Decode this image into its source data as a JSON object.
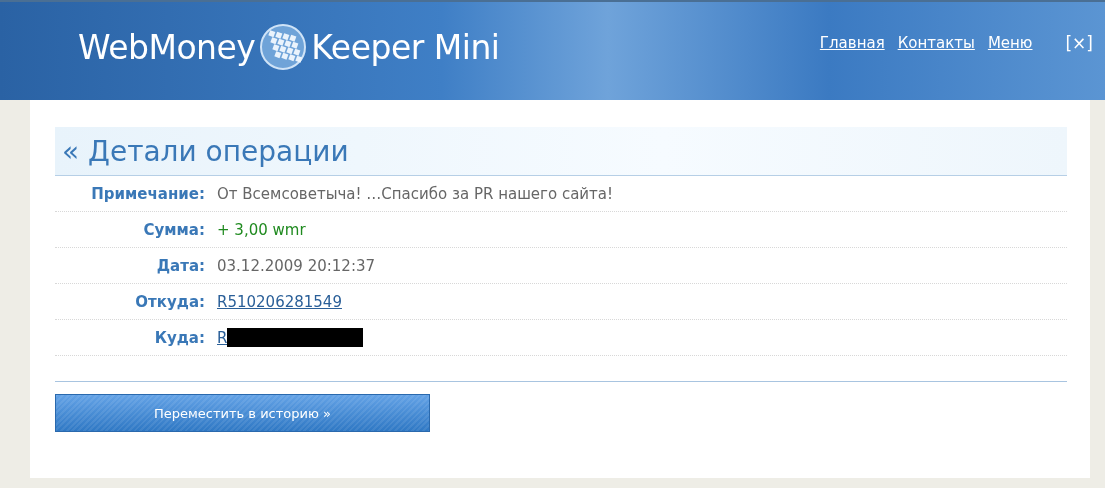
{
  "header": {
    "logo_left": "WebMoney",
    "logo_right": "Keeper Mini",
    "nav": [
      "Главная",
      "Контакты",
      "Меню"
    ],
    "close": "[×]"
  },
  "panel": {
    "title": "« Детали операции",
    "rows": [
      {
        "label": "Примечание:",
        "value": "От Всемсоветыча! …Спасибо за PR нашего сайта!",
        "kind": "text"
      },
      {
        "label": "Сумма:",
        "value": "+ 3,00 wmr",
        "kind": "amount"
      },
      {
        "label": "Дата:",
        "value": "03.12.2009 20:12:37",
        "kind": "text"
      },
      {
        "label": "Откуда:",
        "value": "R510206281549",
        "kind": "link"
      },
      {
        "label": "Куда:",
        "value": "R",
        "kind": "redacted-link"
      }
    ],
    "button": "Переместить в историю »"
  }
}
